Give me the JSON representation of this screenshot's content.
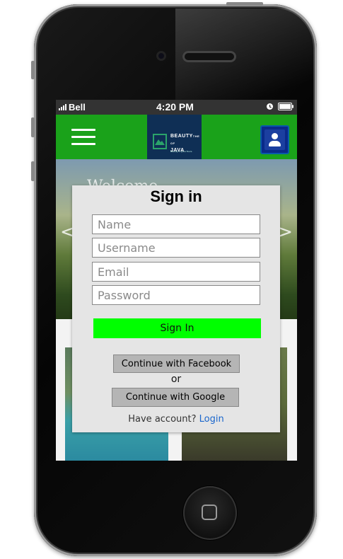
{
  "status_bar": {
    "carrier": "Bell",
    "time": "4:20 PM"
  },
  "navbar": {
    "logo": {
      "line1": "BEAUTY",
      "line2": "OF",
      "line3": "JAVA",
      "tagline": "Beauty in Java Tours",
      "superscript": "THE"
    },
    "accent_color": "#1aa21a"
  },
  "hero": {
    "title": "Welcome"
  },
  "signin_modal": {
    "title": "Sign in",
    "fields": {
      "name_placeholder": "Name",
      "username_placeholder": "Username",
      "email_placeholder": "Email",
      "password_placeholder": "Password"
    },
    "submit_label": "Sign In",
    "facebook_label": "Continue with Facebook",
    "or_text": "or",
    "google_label": "Continue with Google",
    "account_prompt": "Have account?",
    "login_link": "Login"
  },
  "icons": [
    "menu-icon",
    "profile-icon",
    "signal-icon",
    "alarm-icon",
    "battery-icon",
    "carousel-prev-icon",
    "carousel-next-icon"
  ]
}
